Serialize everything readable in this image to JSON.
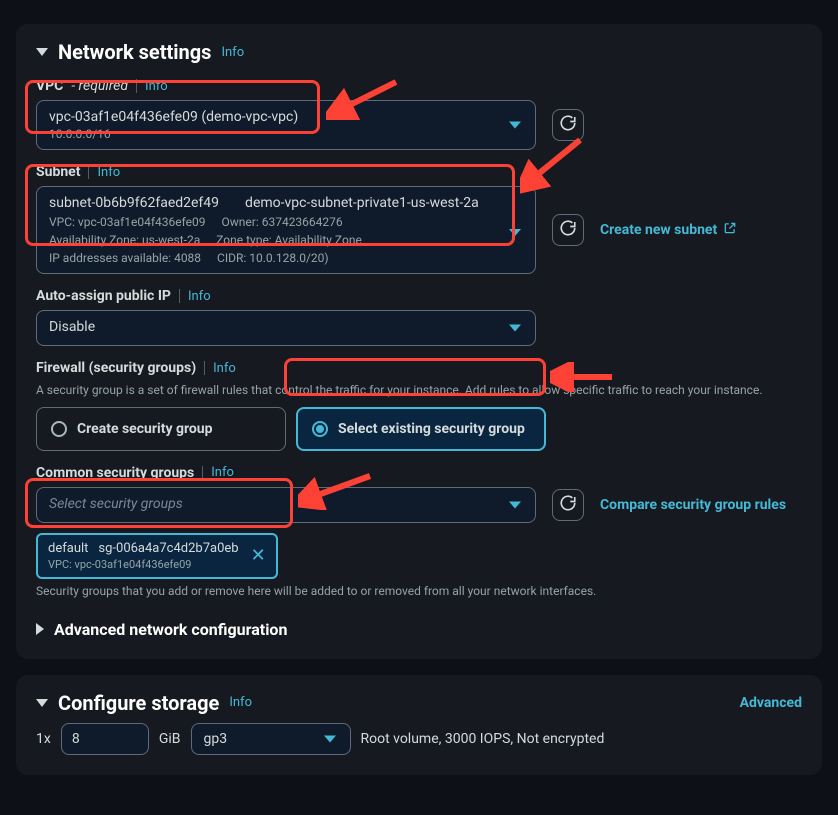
{
  "network": {
    "title": "Network settings",
    "info": "Info",
    "vpc": {
      "label": "VPC",
      "required": "- required",
      "value": "vpc-03af1e04f436efe09 (demo-vpc-vpc)",
      "cidr": "10.0.0.0/16"
    },
    "subnet": {
      "label": "Subnet",
      "id": "subnet-0b6b9f62faed2ef49",
      "name": "demo-vpc-subnet-private1-us-west-2a",
      "vpc": "VPC: vpc-03af1e04f436efe09",
      "owner": "Owner: 637423664276",
      "az": "Availability Zone: us-west-2a",
      "zonetype": "Zone type: Availability Zone",
      "ips": "IP addresses available: 4088",
      "cidr": "CIDR: 10.0.128.0/20)",
      "create_link": "Create new subnet"
    },
    "auto_ip": {
      "label": "Auto-assign public IP",
      "value": "Disable"
    },
    "firewall": {
      "label": "Firewall (security groups)",
      "help": "A security group is a set of firewall rules that control the traffic for your instance. Add rules to allow specific traffic to reach your instance.",
      "create": "Create security group",
      "select": "Select existing security group"
    },
    "common_sg": {
      "label": "Common security groups",
      "placeholder": "Select security groups",
      "compare": "Compare security group rules",
      "chip": {
        "name": "default",
        "id": "sg-006a4a7c4d2b7a0eb",
        "vpc": "VPC: vpc-03af1e04f436efe09"
      },
      "help": "Security groups that you add or remove here will be added to or removed from all your network interfaces."
    },
    "adv_net": "Advanced network configuration"
  },
  "storage": {
    "title": "Configure storage",
    "info": "Info",
    "advanced": "Advanced",
    "qty": "1x",
    "size": "8",
    "unit": "GiB",
    "type": "gp3",
    "desc": "Root volume,  3000 IOPS,  Not encrypted"
  }
}
